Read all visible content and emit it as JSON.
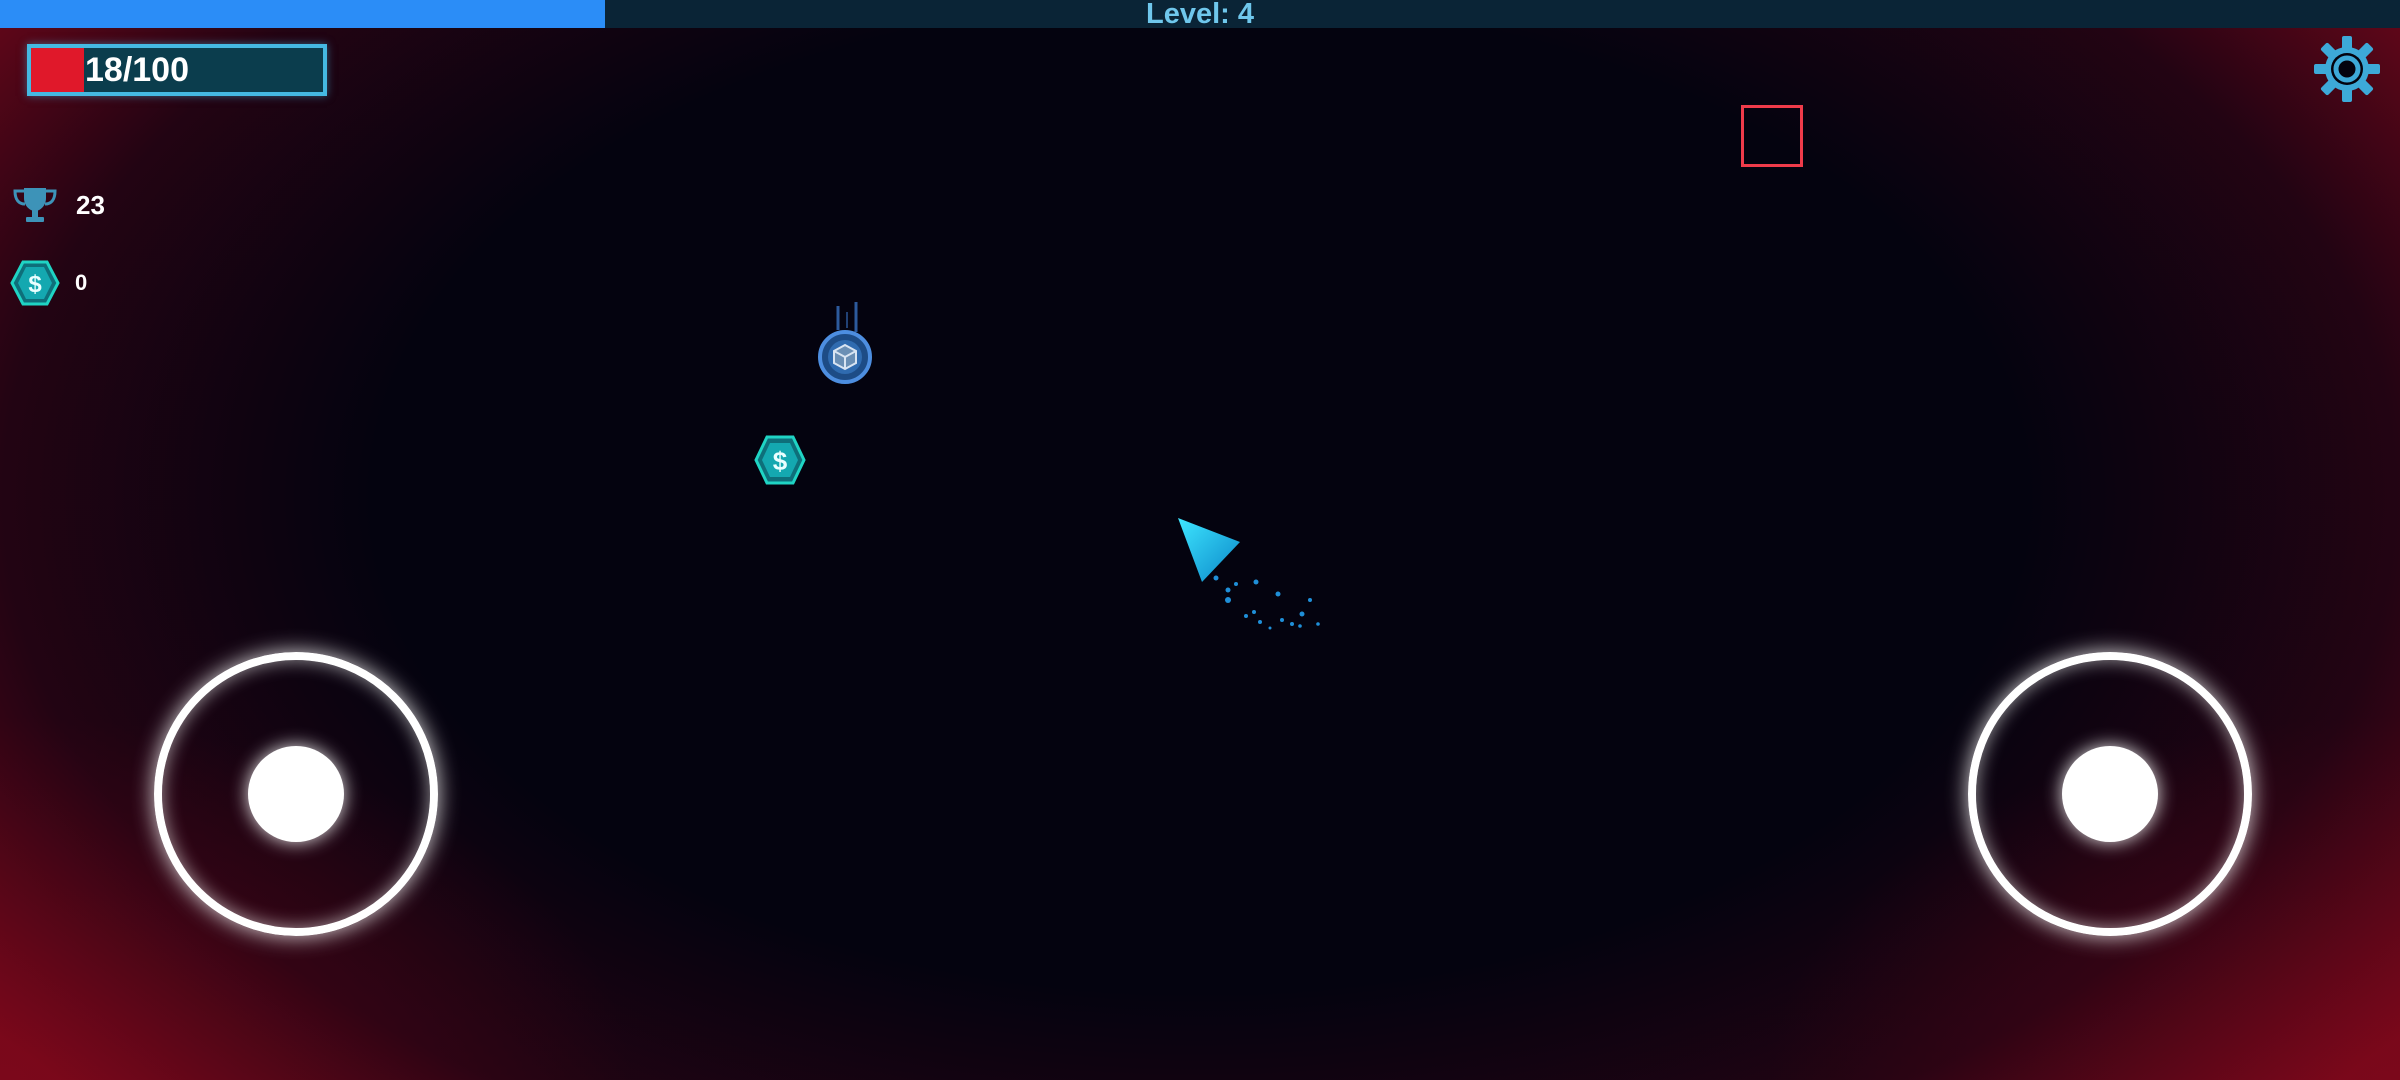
{
  "level": {
    "text": "Level: 4",
    "progress": 0.252,
    "fill_color": "#2b8df7"
  },
  "health": {
    "text": "18/100",
    "current": 18,
    "max": 100,
    "fill_color": "#e0182a"
  },
  "stats": {
    "trophy": {
      "icon": "trophy-icon",
      "value": "23"
    },
    "coins": {
      "icon": "dollar-coin-icon",
      "value": "0"
    }
  },
  "settings": {
    "icon": "gear-icon"
  },
  "colors": {
    "accent": "#45b9e2",
    "player": "#1fc8e8",
    "coin": "#1fd4c4",
    "enemy": "#ef3b4a",
    "background": "#04030f"
  },
  "entities": {
    "player": "player-ship-icon",
    "coin": "dollar-coin-icon",
    "shield_orb": "shield-orb-icon",
    "enemy": "enemy-square"
  },
  "controls": {
    "left": "move-joystick",
    "right": "aim-joystick"
  }
}
